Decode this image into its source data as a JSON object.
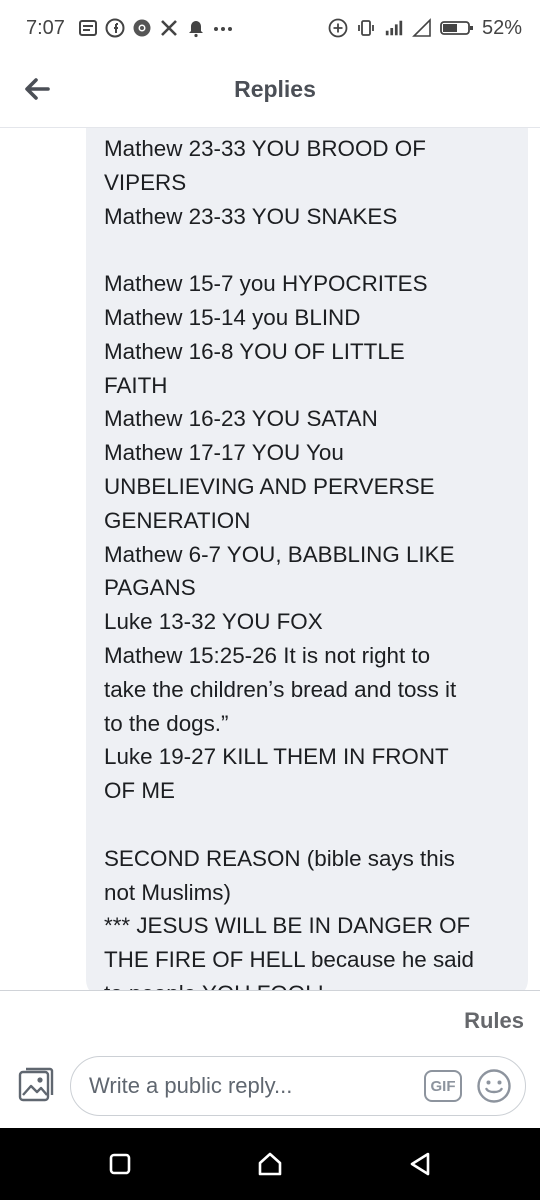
{
  "status_bar": {
    "time": "7:07",
    "battery": "52%",
    "left_icons": [
      "gallery-icon",
      "facebook-icon",
      "chrome-icon",
      "x-icon",
      "alarm-icon",
      "more-dots-icon"
    ],
    "right_icons": [
      "add-circle-icon",
      "vibrate-icon",
      "signal-icon",
      "wifi-icon",
      "battery-icon"
    ]
  },
  "header": {
    "title": "Replies",
    "back_icon": "back-arrow-icon"
  },
  "comment": {
    "lines": [
      "Mathew 23-33 YOU BROOD OF",
      "VIPERS",
      "Mathew 23-33 YOU SNAKES",
      "",
      "Mathew 15-7 you HYPOCRITES",
      "Mathew 15-14 you BLIND",
      "Mathew 16-8 YOU OF LITTLE",
      "FAITH",
      "Mathew 16-23 YOU SATAN",
      "Mathew 17-17 YOU You",
      "UNBELIEVING AND PERVERSE",
      "GENERATION",
      "Mathew 6-7 YOU, BABBLING LIKE",
      "PAGANS",
      "Luke 13-32 YOU FOX",
      "Mathew 15:25-26 It is not right to",
      "take the childrenʼs bread and toss it",
      "to the dogs.”",
      "Luke 19-27 KILL THEM IN FRONT",
      "OF ME",
      "",
      "SECOND REASON (bible says this",
      "not Muslims)",
      "*** JESUS WILL BE IN DANGER OF",
      "THE FIRE OF HELL because he said",
      "to people YOU FOOL!"
    ]
  },
  "footer": {
    "rules_label": "Rules",
    "reply_placeholder": "Write a public reply...",
    "gif_label": "GIF",
    "photo_icon": "photo-icon",
    "emoji_icon": "emoji-icon"
  },
  "nav_bar": {
    "icons": [
      "recents-icon",
      "home-icon",
      "back-icon"
    ]
  },
  "colors": {
    "bubble_bg": "#eef0f4",
    "text": "#1c1e21",
    "secondary_text": "#65676b",
    "nav_bar_bg": "#000000"
  }
}
